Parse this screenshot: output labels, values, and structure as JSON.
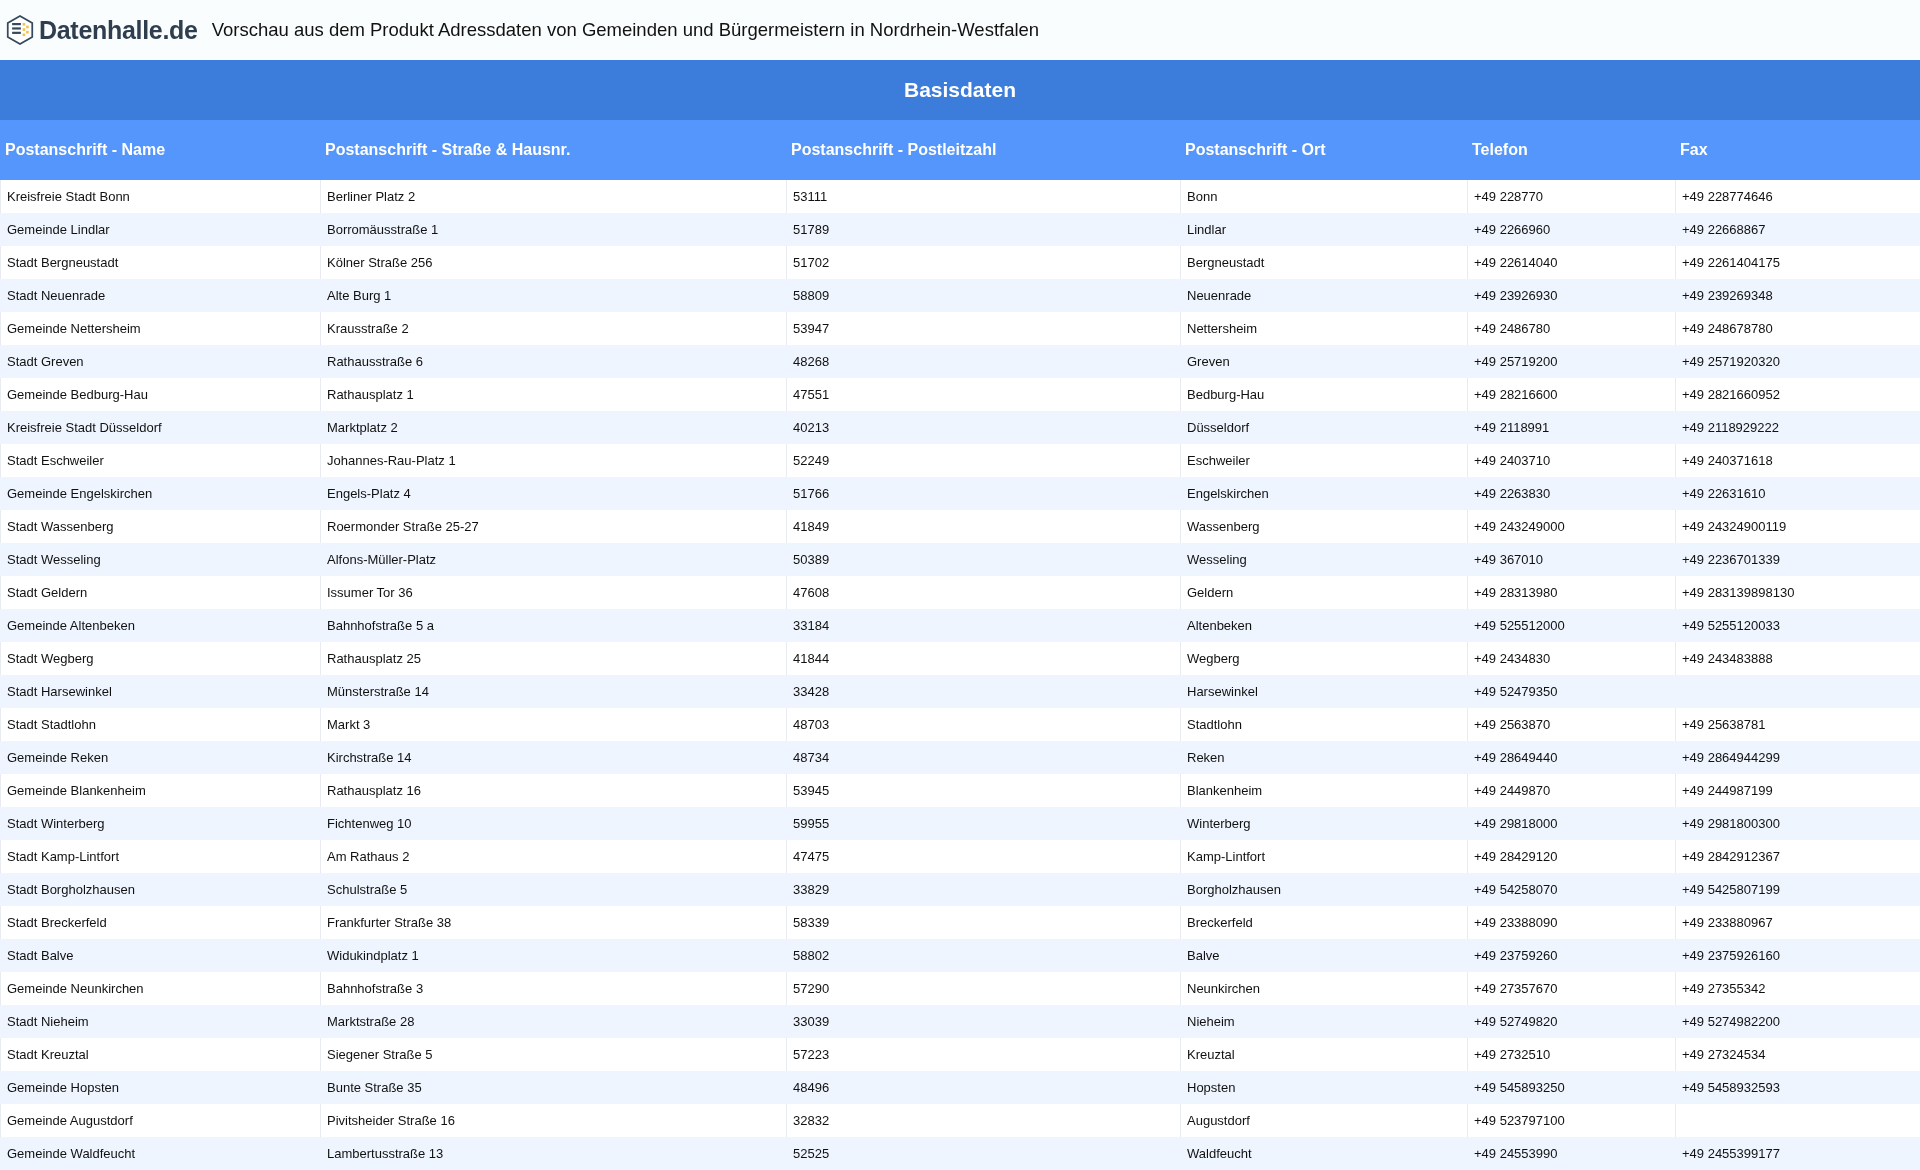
{
  "header": {
    "logo_text": "Datenhalle.de",
    "title": "Vorschau aus dem Produkt Adressdaten von Gemeinden und Bürgermeistern in Nordrhein-Westfalen"
  },
  "table": {
    "group_title": "Basisdaten",
    "columns": [
      "Postanschrift - Name",
      "Postanschrift - Straße & Hausnr.",
      "Postanschrift - Postleitzahl",
      "Postanschrift - Ort",
      "Telefon",
      "Fax"
    ],
    "rows": [
      {
        "name": "Kreisfreie Stadt Bonn",
        "street": "Berliner Platz 2",
        "zip": "53111",
        "city": "Bonn",
        "phone": "+49 228770",
        "fax": "+49 228774646"
      },
      {
        "name": "Gemeinde Lindlar",
        "street": "Borromäusstraße 1",
        "zip": "51789",
        "city": "Lindlar",
        "phone": "+49 2266960",
        "fax": "+49 22668867"
      },
      {
        "name": "Stadt Bergneustadt",
        "street": "Kölner Straße 256",
        "zip": "51702",
        "city": "Bergneustadt",
        "phone": "+49 22614040",
        "fax": "+49 2261404175"
      },
      {
        "name": "Stadt Neuenrade",
        "street": "Alte Burg 1",
        "zip": "58809",
        "city": "Neuenrade",
        "phone": "+49 23926930",
        "fax": "+49 239269348"
      },
      {
        "name": "Gemeinde Nettersheim",
        "street": "Krausstraße 2",
        "zip": "53947",
        "city": "Nettersheim",
        "phone": "+49 2486780",
        "fax": "+49 248678780"
      },
      {
        "name": "Stadt Greven",
        "street": "Rathausstraße 6",
        "zip": "48268",
        "city": "Greven",
        "phone": "+49 25719200",
        "fax": "+49 2571920320"
      },
      {
        "name": "Gemeinde Bedburg-Hau",
        "street": "Rathausplatz 1",
        "zip": "47551",
        "city": "Bedburg-Hau",
        "phone": "+49 28216600",
        "fax": "+49 2821660952"
      },
      {
        "name": "Kreisfreie Stadt Düsseldorf",
        "street": "Marktplatz 2",
        "zip": "40213",
        "city": "Düsseldorf",
        "phone": "+49 2118991",
        "fax": "+49 2118929222"
      },
      {
        "name": "Stadt Eschweiler",
        "street": "Johannes-Rau-Platz 1",
        "zip": "52249",
        "city": "Eschweiler",
        "phone": "+49 2403710",
        "fax": "+49 240371618"
      },
      {
        "name": "Gemeinde Engelskirchen",
        "street": "Engels-Platz 4",
        "zip": "51766",
        "city": "Engelskirchen",
        "phone": "+49 2263830",
        "fax": "+49 22631610"
      },
      {
        "name": "Stadt Wassenberg",
        "street": "Roermonder Straße 25-27",
        "zip": "41849",
        "city": "Wassenberg",
        "phone": "+49 243249000",
        "fax": "+49 24324900119"
      },
      {
        "name": "Stadt Wesseling",
        "street": "Alfons-Müller-Platz",
        "zip": "50389",
        "city": "Wesseling",
        "phone": "+49 367010",
        "fax": "+49 2236701339"
      },
      {
        "name": "Stadt Geldern",
        "street": "Issumer Tor 36",
        "zip": "47608",
        "city": "Geldern",
        "phone": "+49 28313980",
        "fax": "+49 283139898130"
      },
      {
        "name": "Gemeinde Altenbeken",
        "street": "Bahnhofstraße 5 a",
        "zip": "33184",
        "city": "Altenbeken",
        "phone": "+49 525512000",
        "fax": "+49 5255120033"
      },
      {
        "name": "Stadt Wegberg",
        "street": "Rathausplatz 25",
        "zip": "41844",
        "city": "Wegberg",
        "phone": "+49 2434830",
        "fax": "+49 243483888"
      },
      {
        "name": "Stadt Harsewinkel",
        "street": "Münsterstraße 14",
        "zip": "33428",
        "city": "Harsewinkel",
        "phone": "+49 52479350"
      },
      {
        "name": "Stadt Stadtlohn",
        "street": "Markt 3",
        "zip": "48703",
        "city": "Stadtlohn",
        "phone": "+49 2563870",
        "fax": "+49 25638781"
      },
      {
        "name": "Gemeinde Reken",
        "street": "Kirchstraße 14",
        "zip": "48734",
        "city": "Reken",
        "phone": "+49 28649440",
        "fax": "+49 2864944299"
      },
      {
        "name": "Gemeinde Blankenheim",
        "street": "Rathausplatz 16",
        "zip": "53945",
        "city": "Blankenheim",
        "phone": "+49 2449870",
        "fax": "+49 244987199"
      },
      {
        "name": "Stadt Winterberg",
        "street": "Fichtenweg 10",
        "zip": "59955",
        "city": "Winterberg",
        "phone": "+49 29818000",
        "fax": "+49 2981800300"
      },
      {
        "name": "Stadt Kamp-Lintfort",
        "street": "Am Rathaus 2",
        "zip": "47475",
        "city": "Kamp-Lintfort",
        "phone": "+49 28429120",
        "fax": "+49 2842912367"
      },
      {
        "name": "Stadt Borgholzhausen",
        "street": "Schulstraße 5",
        "zip": "33829",
        "city": "Borgholzhausen",
        "phone": "+49 54258070",
        "fax": "+49 5425807199"
      },
      {
        "name": "Stadt Breckerfeld",
        "street": "Frankfurter Straße 38",
        "zip": "58339",
        "city": "Breckerfeld",
        "phone": "+49 23388090",
        "fax": "+49 233880967"
      },
      {
        "name": "Stadt Balve",
        "street": "Widukindplatz 1",
        "zip": "58802",
        "city": "Balve",
        "phone": "+49 23759260",
        "fax": "+49 2375926160"
      },
      {
        "name": "Gemeinde Neunkirchen",
        "street": "Bahnhofstraße 3",
        "zip": "57290",
        "city": "Neunkirchen",
        "phone": "+49 27357670",
        "fax": "+49 27355342"
      },
      {
        "name": "Stadt Nieheim",
        "street": "Marktstraße 28",
        "zip": "33039",
        "city": "Nieheim",
        "phone": "+49 52749820",
        "fax": "+49 5274982200"
      },
      {
        "name": "Stadt Kreuztal",
        "street": "Siegener Straße 5",
        "zip": "57223",
        "city": "Kreuztal",
        "phone": "+49 2732510",
        "fax": "+49 27324534"
      },
      {
        "name": "Gemeinde Hopsten",
        "street": "Bunte Straße 35",
        "zip": "48496",
        "city": "Hopsten",
        "phone": "+49 545893250",
        "fax": "+49 5458932593"
      },
      {
        "name": "Gemeinde Augustdorf",
        "street": "Pivitsheider Straße 16",
        "zip": "32832",
        "city": "Augustdorf",
        "phone": "+49 523797100"
      },
      {
        "name": "Gemeinde Waldfeucht",
        "street": "Lambertusstraße 13",
        "zip": "52525",
        "city": "Waldfeucht",
        "phone": "+49 24553990",
        "fax": "+49 2455399177"
      }
    ]
  }
}
